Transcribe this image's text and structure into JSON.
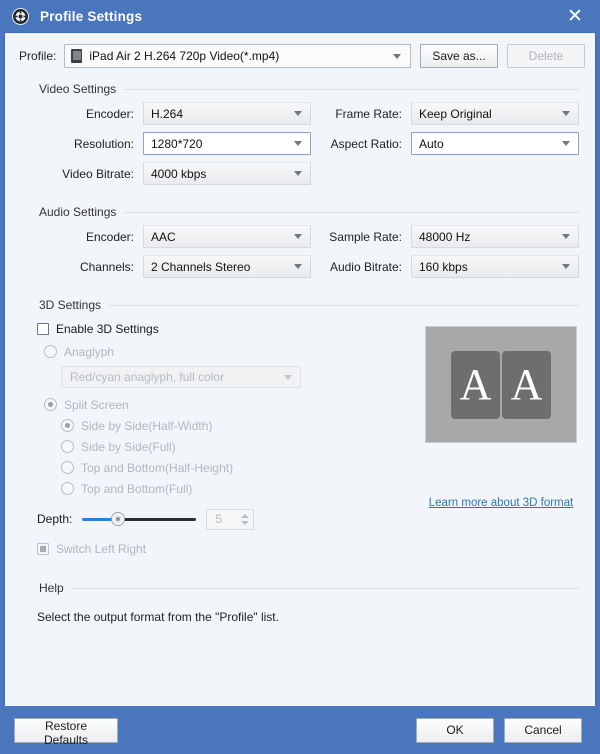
{
  "window": {
    "title": "Profile Settings",
    "app_icon": "gear-icon",
    "close_label": "✕",
    "titlebar_color": "#4a76bd",
    "body_color": "#f2f5fa"
  },
  "profile": {
    "label": "Profile:",
    "value": "iPad Air 2 H.264 720p Video(*.mp4)",
    "device_icon": "tablet-icon",
    "save_as_label": "Save as...",
    "delete_label": "Delete"
  },
  "video": {
    "group_title": "Video Settings",
    "encoder_label": "Encoder:",
    "encoder_value": "H.264",
    "resolution_label": "Resolution:",
    "resolution_value": "1280*720",
    "bitrate_label": "Video Bitrate:",
    "bitrate_value": "4000 kbps",
    "framerate_label": "Frame Rate:",
    "framerate_value": "Keep Original",
    "aspect_label": "Aspect Ratio:",
    "aspect_value": "Auto"
  },
  "audio": {
    "group_title": "Audio Settings",
    "encoder_label": "Encoder:",
    "encoder_value": "AAC",
    "channels_label": "Channels:",
    "channels_value": "2 Channels Stereo",
    "samplerate_label": "Sample Rate:",
    "samplerate_value": "48000 Hz",
    "bitrate_label": "Audio Bitrate:",
    "bitrate_value": "160 kbps"
  },
  "threed": {
    "group_title": "3D Settings",
    "enable_label": "Enable 3D Settings",
    "anaglyph_label": "Anaglyph",
    "anaglyph_mode_value": "Red/cyan anaglyph, full color",
    "split_screen_label": "Split Screen",
    "split_options": [
      "Side by Side(Half-Width)",
      "Side by Side(Full)",
      "Top and Bottom(Half-Height)",
      "Top and Bottom(Full)"
    ],
    "depth_label": "Depth:",
    "depth_value": "5",
    "switch_lr_label": "Switch Left Right",
    "learn_more_label": "Learn more about 3D format",
    "preview_letter_left": "A",
    "preview_letter_right": "A",
    "link_color": "#2a7ab0"
  },
  "help": {
    "group_title": "Help",
    "text": "Select the output format from the \"Profile\" list."
  },
  "footer": {
    "restore_label": "Restore Defaults",
    "ok_label": "OK",
    "cancel_label": "Cancel"
  }
}
